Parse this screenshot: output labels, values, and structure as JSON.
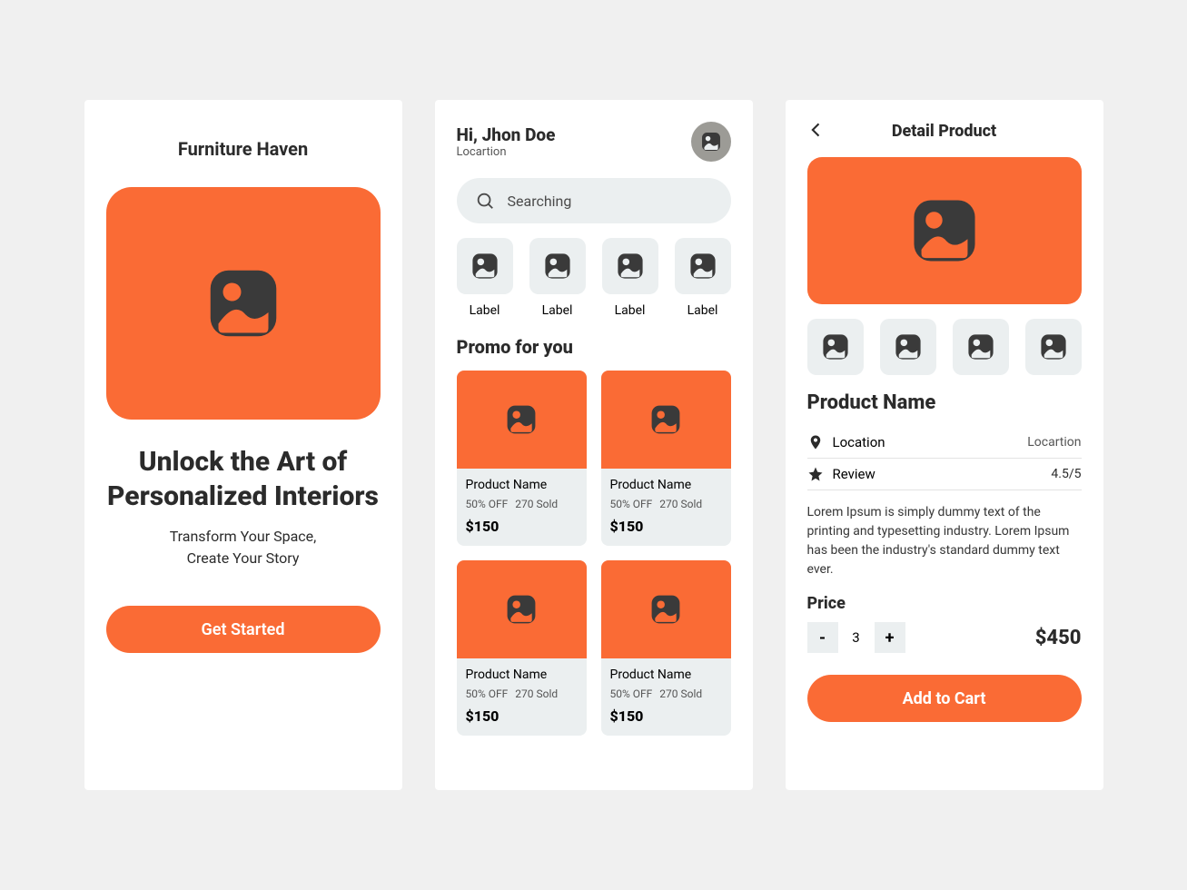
{
  "onboard": {
    "brand": "Furniture Haven",
    "headline": "Unlock the Art of Personalized Interiors",
    "sub1": "Transform Your Space,",
    "sub2": "Create Your Story",
    "cta": "Get Started"
  },
  "home": {
    "greeting": "Hi, Jhon Doe",
    "location": "Locartion",
    "search_placeholder": "Searching",
    "categories": [
      {
        "label": "Label"
      },
      {
        "label": "Label"
      },
      {
        "label": "Label"
      },
      {
        "label": "Label"
      }
    ],
    "promo_title": "Promo for you",
    "products": [
      {
        "name": "Product Name",
        "discount": "50% OFF",
        "sold": "270 Sold",
        "price": "$150"
      },
      {
        "name": "Product Name",
        "discount": "50% OFF",
        "sold": "270 Sold",
        "price": "$150"
      },
      {
        "name": "Product Name",
        "discount": "50% OFF",
        "sold": "270 Sold",
        "price": "$150"
      },
      {
        "name": "Product Name",
        "discount": "50% OFF",
        "sold": "270 Sold",
        "price": "$150"
      }
    ]
  },
  "detail": {
    "title": "Detail Product",
    "name": "Product Name",
    "location_label": "Location",
    "location_value": "Locartion",
    "review_label": "Review",
    "review_value": "4.5/5",
    "description": "Lorem Ipsum is simply dummy text of the printing and typesetting industry. Lorem Ipsum has been the industry's standard dummy text ever.",
    "price_label": "Price",
    "qty": "3",
    "price": "$450",
    "add": "Add to Cart"
  }
}
